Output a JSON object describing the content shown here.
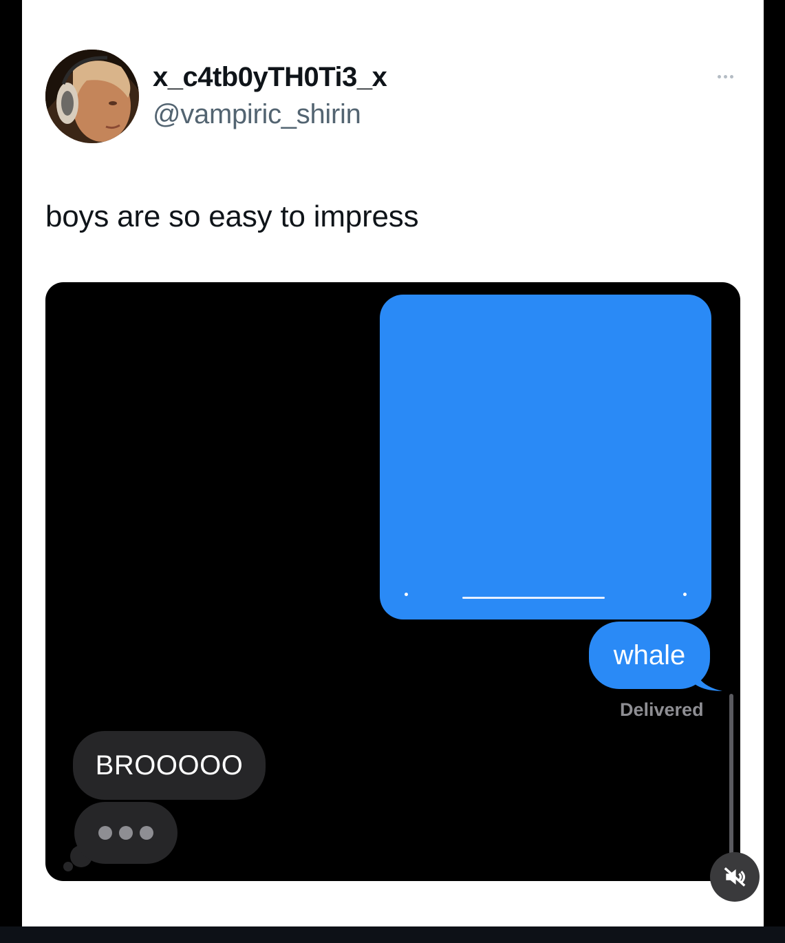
{
  "post": {
    "display_name": "x_c4tb0yTH0Ti3_x",
    "handle": "@vampiric_shirin",
    "text": "boys are so easy to impress",
    "more_icon": "more-horizontal-icon"
  },
  "media": {
    "messages": [
      {
        "side": "sent",
        "text": "whale"
      },
      {
        "side": "received",
        "text": "BROOOOO"
      }
    ],
    "delivered_label": "Delivered",
    "typing_indicator": true,
    "mute_icon": "speaker-muted-icon"
  },
  "colors": {
    "imessage_blue": "#2a8af6",
    "received_bubble": "#262628",
    "text_primary": "#0f1419",
    "text_secondary": "#536471"
  }
}
